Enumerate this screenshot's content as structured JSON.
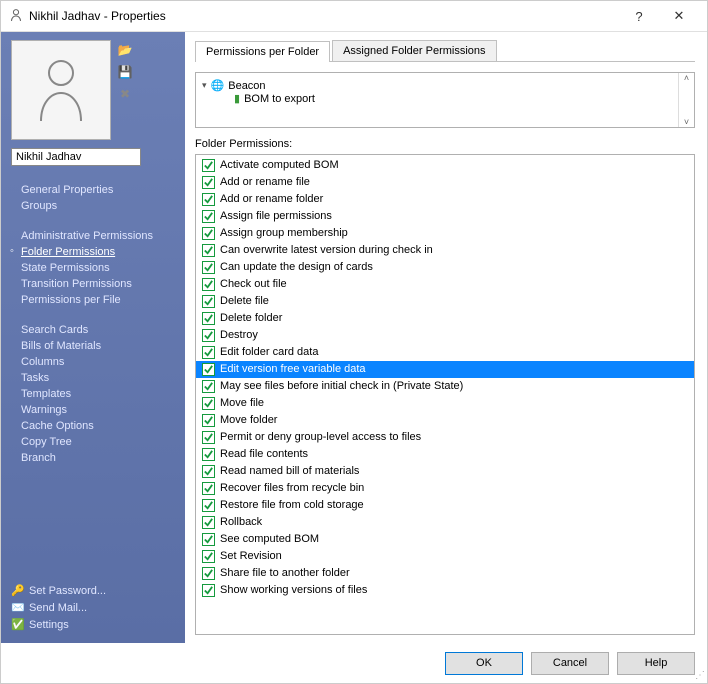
{
  "window": {
    "title": "Nikhil Jadhav - Properties"
  },
  "sidebar": {
    "user_name": "Nikhil Jadhav",
    "groups": [
      {
        "items": [
          {
            "label": "General Properties"
          },
          {
            "label": "Groups"
          }
        ]
      },
      {
        "items": [
          {
            "label": "Administrative Permissions"
          },
          {
            "label": "Folder Permissions",
            "selected": true
          },
          {
            "label": "State Permissions"
          },
          {
            "label": "Transition Permissions"
          },
          {
            "label": "Permissions per File"
          }
        ]
      },
      {
        "items": [
          {
            "label": "Search Cards"
          },
          {
            "label": "Bills of Materials"
          },
          {
            "label": "Columns"
          },
          {
            "label": "Tasks"
          },
          {
            "label": "Templates"
          },
          {
            "label": "Warnings"
          },
          {
            "label": "Cache Options"
          },
          {
            "label": "Copy Tree"
          },
          {
            "label": "Branch"
          }
        ]
      }
    ],
    "bottom": [
      {
        "icon": "key",
        "label": "Set Password..."
      },
      {
        "icon": "mail",
        "label": "Send Mail..."
      },
      {
        "icon": "check",
        "label": "Settings"
      }
    ]
  },
  "tabs": [
    {
      "label": "Permissions per Folder",
      "active": true
    },
    {
      "label": "Assigned Folder Permissions",
      "active": false
    }
  ],
  "tree": {
    "root": "Beacon",
    "child": "BOM to export"
  },
  "section_label": "Folder Permissions:",
  "permissions": [
    {
      "label": "Activate computed BOM",
      "checked": true
    },
    {
      "label": "Add or rename file",
      "checked": true
    },
    {
      "label": "Add or rename folder",
      "checked": true
    },
    {
      "label": "Assign file permissions",
      "checked": true
    },
    {
      "label": "Assign group membership",
      "checked": true
    },
    {
      "label": "Can overwrite latest version during check in",
      "checked": true
    },
    {
      "label": "Can update the design of cards",
      "checked": true
    },
    {
      "label": "Check out file",
      "checked": true
    },
    {
      "label": "Delete file",
      "checked": true
    },
    {
      "label": "Delete folder",
      "checked": true
    },
    {
      "label": "Destroy",
      "checked": true
    },
    {
      "label": "Edit folder card data",
      "checked": true
    },
    {
      "label": "Edit version free variable data",
      "checked": true,
      "selected": true
    },
    {
      "label": "May see files before initial check in (Private State)",
      "checked": true
    },
    {
      "label": "Move file",
      "checked": true
    },
    {
      "label": "Move folder",
      "checked": true
    },
    {
      "label": "Permit or deny group-level access to files",
      "checked": true
    },
    {
      "label": "Read file contents",
      "checked": true
    },
    {
      "label": "Read named bill of materials",
      "checked": true
    },
    {
      "label": "Recover files from recycle bin",
      "checked": true
    },
    {
      "label": "Restore file from cold storage",
      "checked": true
    },
    {
      "label": "Rollback",
      "checked": true
    },
    {
      "label": "See computed BOM",
      "checked": true
    },
    {
      "label": "Set Revision",
      "checked": true
    },
    {
      "label": "Share file to another folder",
      "checked": true
    },
    {
      "label": "Show working versions of files",
      "checked": true
    }
  ],
  "buttons": {
    "ok": "OK",
    "cancel": "Cancel",
    "help": "Help"
  }
}
